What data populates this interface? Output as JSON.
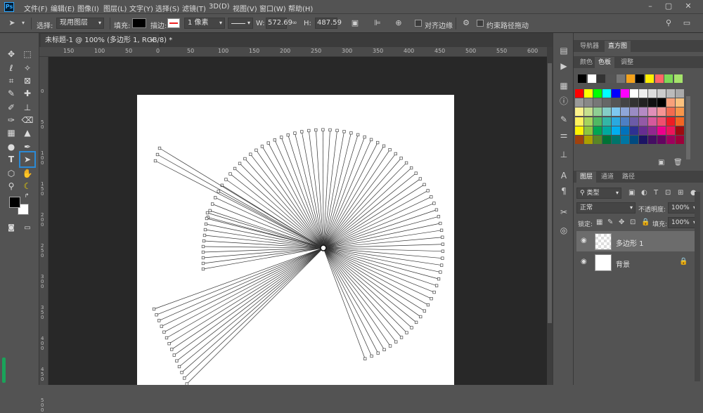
{
  "menu": {
    "logo": "Ps",
    "items": [
      "文件(F)",
      "编辑(E)",
      "图像(I)",
      "图层(L)",
      "文字(Y)",
      "选择(S)",
      "滤镜(T)",
      "3D(D)",
      "视图(V)",
      "窗口(W)",
      "帮助(H)"
    ],
    "window_controls": [
      "–",
      "▢",
      "✕"
    ]
  },
  "options": {
    "select_label": "选择:",
    "select_value": "现用图层",
    "fill_label": "填充:",
    "stroke_label": "描边:",
    "stroke_width": "1 像素",
    "w_label": "W:",
    "w_value": "572.69",
    "h_label": "H:",
    "h_value": "487.59",
    "align_edges_label": "对齐边缘",
    "constrain_path_label": "约束路径拖动"
  },
  "document": {
    "tab_title": "未标题-1 @ 100% (多边形 1, RGB/8) *",
    "close": "×"
  },
  "ruler": {
    "h_labels": [
      "150",
      "100",
      "50",
      "0",
      "50",
      "100",
      "150",
      "200",
      "250",
      "300",
      "350",
      "400",
      "450",
      "500",
      "550",
      "600",
      "650"
    ],
    "v_labels": [
      "0",
      "50",
      "100",
      "150",
      "200",
      "250",
      "300",
      "350",
      "400",
      "450",
      "500"
    ]
  },
  "panels": {
    "top_tabs": [
      "导航器",
      "直方图"
    ],
    "swatch_tabs": [
      "颜色",
      "色板",
      "调整"
    ],
    "layer_tabs": [
      "图层",
      "通道",
      "路径"
    ],
    "kind_filter": "类型",
    "blend_mode": "正常",
    "opacity_label": "不透明度:",
    "opacity_value": "100%",
    "lock_label": "锁定:",
    "fill_label": "填充:",
    "fill_value": "100%",
    "layers": [
      {
        "name": "多边形 1"
      },
      {
        "name": "背景"
      }
    ]
  },
  "colors": {
    "swatches_row1": [
      "#000000",
      "#ffffff",
      "#333333",
      "#555555",
      "#777777",
      "#f4a21b",
      "#000000",
      "#ffee00",
      "#ff6666",
      "#7ed957",
      "#a5e36b"
    ],
    "swatches_grid": [
      [
        "#ff0000",
        "#ffff00",
        "#00ff00",
        "#00ffff",
        "#0000ff",
        "#ff00ff",
        "#ffffff",
        "#eeeeee",
        "#dddddd",
        "#cccccc",
        "#bbbbbb",
        "#aaaaaa"
      ],
      [
        "#999999",
        "#888888",
        "#777777",
        "#666666",
        "#555555",
        "#444444",
        "#333333",
        "#222222",
        "#111111",
        "#000000",
        "#f8a07a",
        "#fbc17e"
      ],
      [
        "#fdf28c",
        "#c7e08e",
        "#8fce93",
        "#85cdc7",
        "#7ec8f0",
        "#8ea6d8",
        "#9a8cc4",
        "#b48ac4",
        "#e08fb8",
        "#f59494",
        "#f26b4f",
        "#f7964a"
      ],
      [
        "#fff15d",
        "#a5d45d",
        "#4fb862",
        "#33b6a6",
        "#2aa9e0",
        "#4d7fc4",
        "#6b5ba7",
        "#9359a6",
        "#d6589c",
        "#ef4e6f",
        "#ed1c24",
        "#f26522"
      ],
      [
        "#fff200",
        "#8dc63f",
        "#00a651",
        "#00a99d",
        "#00aeef",
        "#0072bc",
        "#2e3192",
        "#662d91",
        "#92278f",
        "#ec008c",
        "#ed145b",
        "#9e0b0f"
      ],
      [
        "#a0410d",
        "#aba000",
        "#598527",
        "#007236",
        "#00746b",
        "#0076a3",
        "#004a80",
        "#1b1464",
        "#440e62",
        "#630460",
        "#9e005d",
        "#9e0039"
      ]
    ]
  }
}
